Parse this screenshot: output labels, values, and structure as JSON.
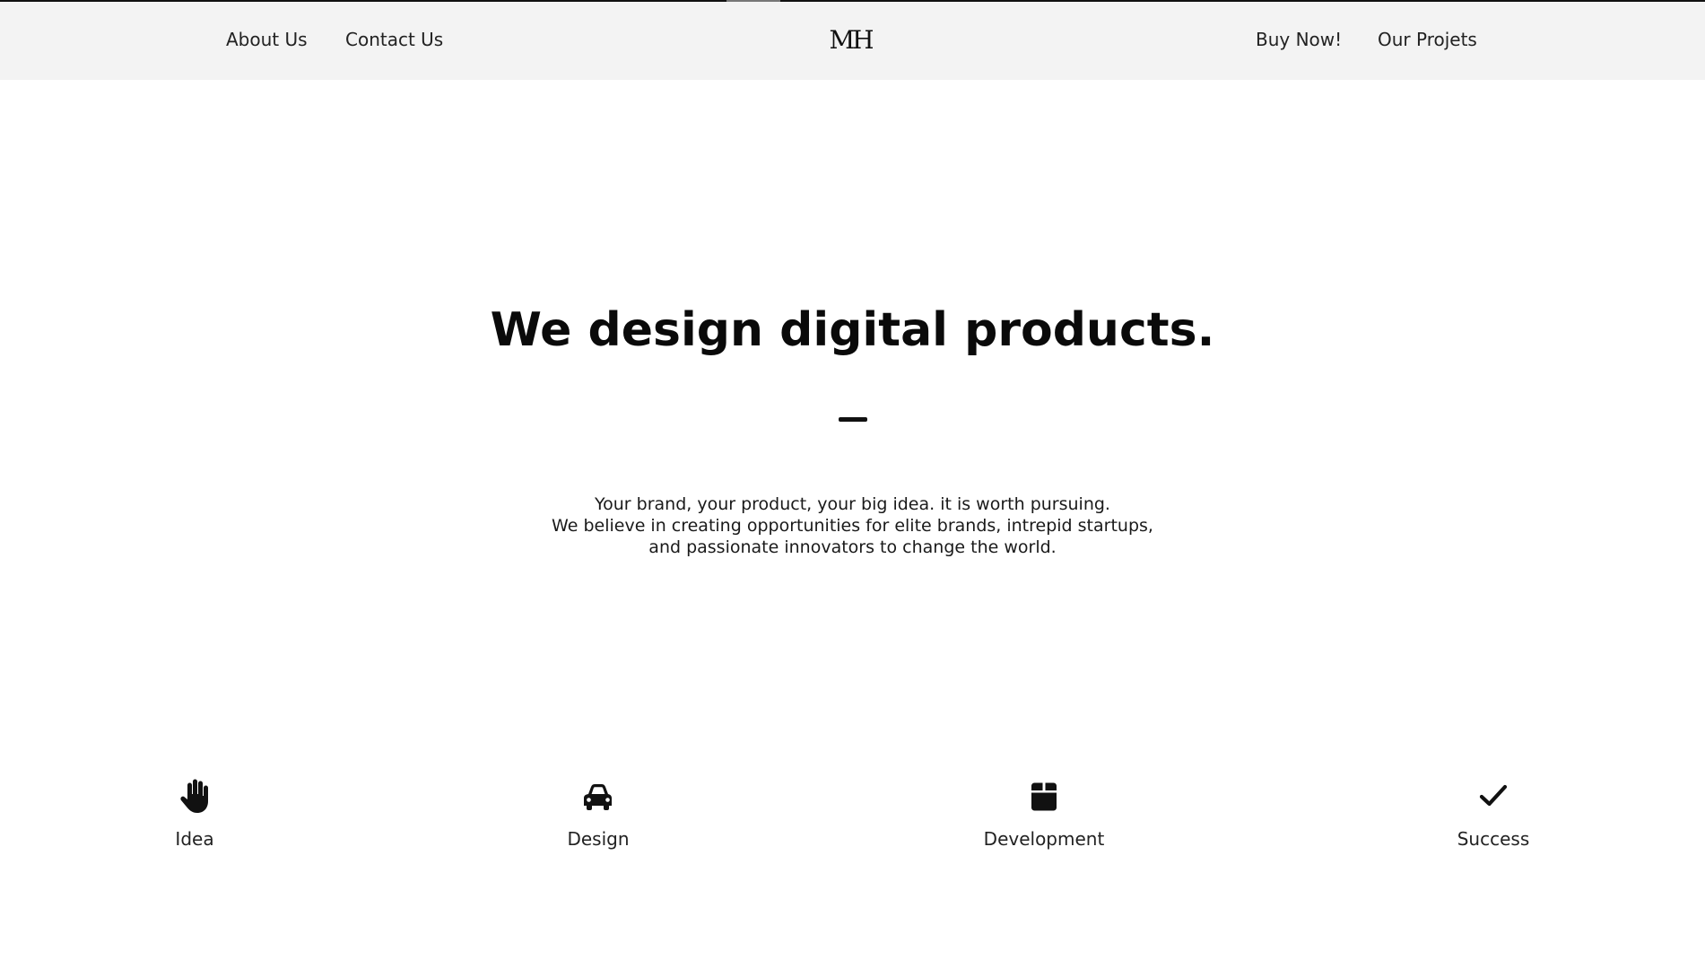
{
  "nav": {
    "left": [
      "About Us",
      "Contact Us"
    ],
    "logo": "MH",
    "right": [
      "Buy Now!",
      "Our Projets"
    ]
  },
  "hero": {
    "title": "We design digital products.",
    "lines": [
      "Your brand, your product, your big idea. it is worth pursuing.",
      "We believe in creating opportunities for elite brands, intrepid startups,",
      "and passionate innovators to change the world."
    ]
  },
  "features": [
    {
      "label": "Idea",
      "icon": "hand-icon"
    },
    {
      "label": "Design",
      "icon": "car-icon"
    },
    {
      "label": "Development",
      "icon": "box-icon"
    },
    {
      "label": "Success",
      "icon": "check-icon"
    }
  ]
}
